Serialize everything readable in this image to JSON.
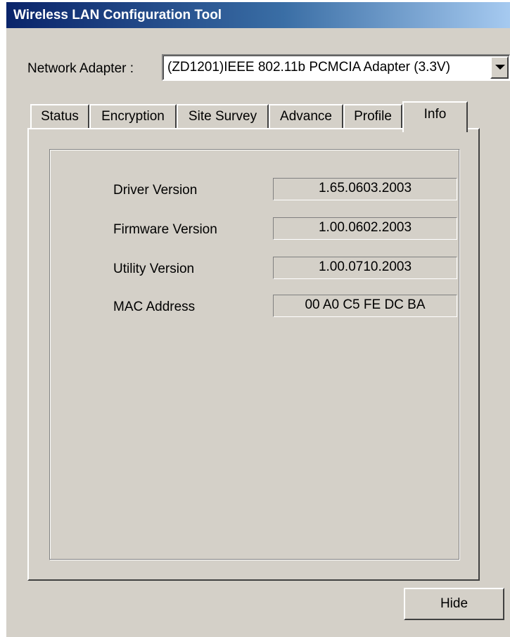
{
  "window": {
    "title": "Wireless LAN Configuration Tool"
  },
  "adapter": {
    "label": "Network Adapter :",
    "selected": "(ZD1201)IEEE 802.11b PCMCIA Adapter (3.3V)",
    "dropdown_icon": "chevron-down-icon"
  },
  "tabs": [
    {
      "label": "Status"
    },
    {
      "label": "Encryption"
    },
    {
      "label": "Site Survey"
    },
    {
      "label": "Advance"
    },
    {
      "label": "Profile"
    },
    {
      "label": "Info"
    }
  ],
  "active_tab": "Info",
  "info": {
    "rows": [
      {
        "label": "Driver Version",
        "value": "1.65.0603.2003"
      },
      {
        "label": "Firmware Version",
        "value": "1.00.0602.2003"
      },
      {
        "label": "Utility Version",
        "value": "1.00.0710.2003"
      },
      {
        "label": "MAC Address",
        "value": "00 A0 C5 FE DC BA"
      }
    ]
  },
  "buttons": {
    "hide_label": "Hide"
  },
  "colors": {
    "title_start": "#0a246a",
    "title_end": "#a6caf0",
    "face": "#d4d0c8"
  }
}
